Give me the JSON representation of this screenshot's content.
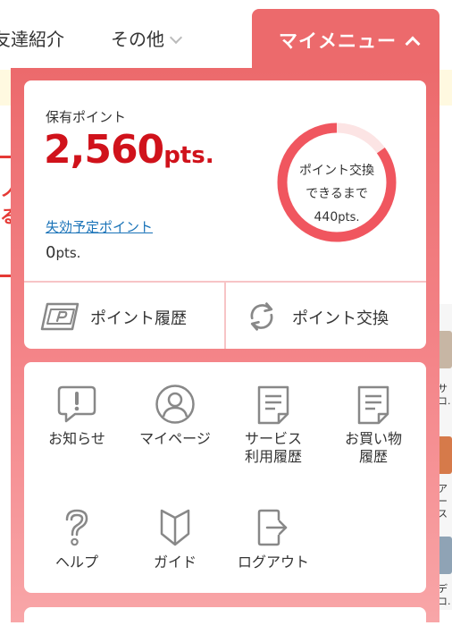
{
  "nav": {
    "item_friend": "友達紹介",
    "item_other": "その他",
    "my_menu": "マイメニュー"
  },
  "points": {
    "held_label": "保有ポイント",
    "held_value": "2,560",
    "held_unit": "pts.",
    "expire_label": "失効予定ポイント",
    "expire_value": "0",
    "expire_unit": "pts.",
    "exchange_line1": "ポイント交換",
    "exchange_line2": "できるまで",
    "exchange_remaining": "440",
    "exchange_unit": "pts.",
    "progress_fraction": 0.85
  },
  "actions": {
    "history_label": "ポイント履歴",
    "exchange_label": "ポイント交換"
  },
  "menu": {
    "notice": "お知らせ",
    "mypage": "マイページ",
    "service_history_1": "サービス",
    "service_history_2": "利用履歴",
    "purchase_history_1": "お買い物",
    "purchase_history_2": "履歴",
    "help": "ヘルプ",
    "guide": "ガイド",
    "logout": "ログアウト"
  },
  "background": {
    "fragments": [
      "ノ",
      "る",
      "サ",
      "コ.",
      "ア",
      "ース",
      "デ",
      "コ."
    ]
  },
  "colors": {
    "accent": "#ec6a6c",
    "points_red": "#d0121b",
    "ring": "#f0565f",
    "link": "#1a73b8"
  },
  "icons": [
    "point-card-icon",
    "exchange-icon",
    "notice-icon",
    "user-icon",
    "document-icon",
    "help-icon",
    "guide-icon",
    "logout-icon",
    "chevron-down-icon",
    "chevron-up-icon"
  ]
}
